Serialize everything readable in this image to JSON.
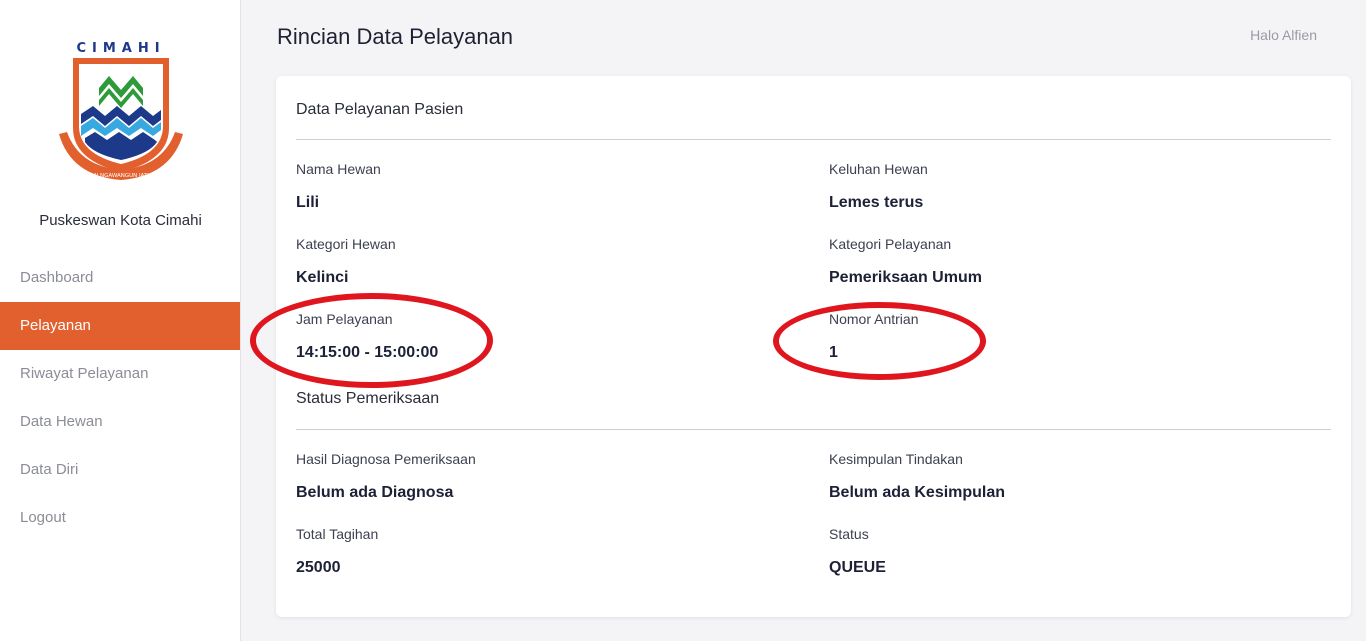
{
  "sidebar": {
    "logo_text": "CIMAHI",
    "logo_motto": "SAUYUNAN NGAWANGUN JATI MANDIRI",
    "org_name": "Puskeswan Kota Cimahi",
    "items": [
      {
        "label": "Dashboard",
        "active": false
      },
      {
        "label": "Pelayanan",
        "active": true
      },
      {
        "label": "Riwayat Pelayanan",
        "active": false
      },
      {
        "label": "Data Hewan",
        "active": false
      },
      {
        "label": "Data Diri",
        "active": false
      },
      {
        "label": "Logout",
        "active": false
      }
    ]
  },
  "header": {
    "title": "Rincian Data Pelayanan",
    "greeting": "Halo Alfien"
  },
  "card": {
    "pasien": {
      "title": "Data Pelayanan Pasien",
      "nama_hewan": {
        "label": "Nama Hewan",
        "value": "Lili"
      },
      "keluhan_hewan": {
        "label": "Keluhan Hewan",
        "value": "Lemes terus"
      },
      "kategori_hewan": {
        "label": "Kategori Hewan",
        "value": "Kelinci"
      },
      "kategori_pelayanan": {
        "label": "Kategori Pelayanan",
        "value": "Pemeriksaan Umum"
      },
      "jam_pelayanan": {
        "label": "Jam Pelayanan",
        "value": "14:15:00 - 15:00:00"
      },
      "nomor_antrian": {
        "label": "Nomor Antrian",
        "value": "1"
      }
    },
    "status": {
      "title": "Status Pemeriksaan",
      "hasil_diagnosa": {
        "label": "Hasil Diagnosa Pemeriksaan",
        "value": "Belum ada Diagnosa"
      },
      "kesimpulan": {
        "label": "Kesimpulan Tindakan",
        "value": "Belum ada Kesimpulan"
      },
      "total_tagihan": {
        "label": "Total Tagihan",
        "value": "25000"
      },
      "status": {
        "label": "Status",
        "value": "QUEUE"
      }
    }
  },
  "colors": {
    "accent": "#e2602e",
    "annotation": "#e0161f",
    "logo_blue": "#1d3a8a",
    "logo_green": "#2e9b3a",
    "logo_sky": "#37a8e0"
  }
}
